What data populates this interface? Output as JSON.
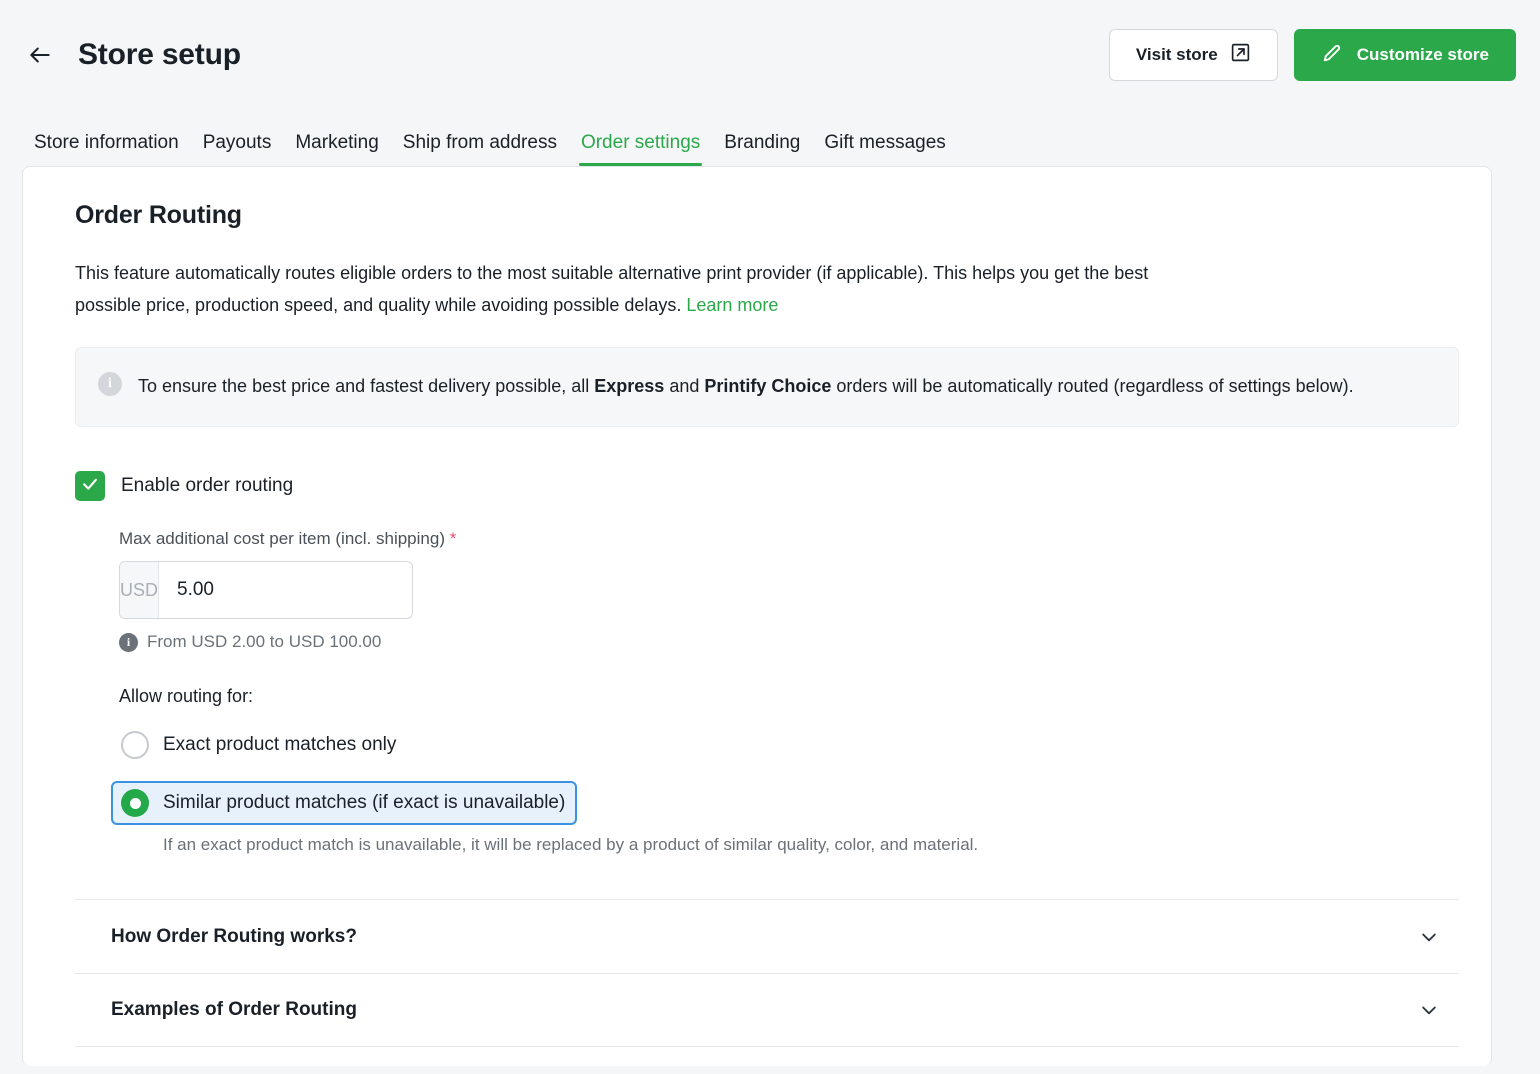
{
  "header": {
    "back_icon": "arrow-left-icon",
    "title": "Store setup",
    "visit_store_label": "Visit store",
    "visit_store_icon": "external-link-icon",
    "customize_store_label": "Customize store",
    "customize_store_icon": "pencil-icon"
  },
  "tabs": [
    {
      "label": "Store information",
      "active": false
    },
    {
      "label": "Payouts",
      "active": false
    },
    {
      "label": "Marketing",
      "active": false
    },
    {
      "label": "Ship from address",
      "active": false
    },
    {
      "label": "Order settings",
      "active": true
    },
    {
      "label": "Branding",
      "active": false
    },
    {
      "label": "Gift messages",
      "active": false
    }
  ],
  "section": {
    "title": "Order Routing",
    "description_line1": "This feature automatically routes eligible orders to the most suitable alternative print provider (if applicable). This",
    "description_line2": "helps you get the best possible price, production speed, and quality while avoiding possible delays.",
    "learn_more_label": "Learn more"
  },
  "banner": {
    "icon": "info-icon",
    "prefix": "To ensure the best price and fastest delivery possible, all ",
    "bold1": "Express",
    "middle": " and ",
    "bold2": "Printify Choice",
    "suffix": " orders will be automatically routed (regardless of settings below)."
  },
  "enable_routing": {
    "checked": true,
    "label": "Enable order routing",
    "check_icon": "check-icon"
  },
  "max_cost_field": {
    "label": "Max additional cost per item (incl. shipping)",
    "required_marker": "*",
    "currency_prefix": "USD",
    "value": "5.00",
    "placeholder": "0.00",
    "hint_icon": "info-icon",
    "hint": "From USD 2.00 to USD 100.00"
  },
  "routing_options": {
    "heading": "Allow routing for:",
    "options": [
      {
        "label": "Exact product matches only",
        "selected": false,
        "focused": false,
        "sub": ""
      },
      {
        "label": "Similar product matches (if exact is unavailable)",
        "selected": true,
        "focused": true,
        "sub": "If an exact product match is unavailable, it will be replaced by a product of similar quality, color, and material."
      }
    ]
  },
  "accordion": [
    {
      "title": "How Order Routing works?",
      "icon": "chevron-down-icon",
      "expanded": false
    },
    {
      "title": "Examples of Order Routing",
      "icon": "chevron-down-icon",
      "expanded": false
    }
  ],
  "colors": {
    "brand_green": "#2BA84A",
    "radio_green": "#23A94A",
    "focus_blue": "#3B92E0",
    "focus_blue_bg": "#E6F1FB",
    "text_dark": "#1A2028",
    "text_muted": "#6B7178",
    "required_red": "#E8516C",
    "page_bg": "#F5F6F7"
  }
}
